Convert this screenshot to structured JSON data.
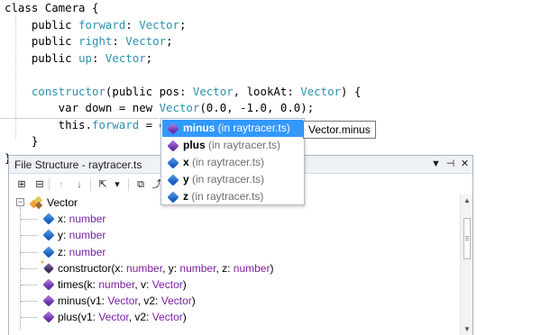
{
  "editor": {
    "lines": [
      [
        {
          "t": "class Camera {",
          "c": "kw"
        }
      ],
      [
        {
          "t": "    public ",
          "c": "kw"
        },
        {
          "t": "forward",
          "c": "field"
        },
        {
          "t": ": ",
          "c": "punct"
        },
        {
          "t": "Vector",
          "c": "type"
        },
        {
          "t": ";",
          "c": "punct"
        }
      ],
      [
        {
          "t": "    public ",
          "c": "kw"
        },
        {
          "t": "right",
          "c": "field"
        },
        {
          "t": ": ",
          "c": "punct"
        },
        {
          "t": "Vector",
          "c": "type"
        },
        {
          "t": ";",
          "c": "punct"
        }
      ],
      [
        {
          "t": "    public ",
          "c": "kw"
        },
        {
          "t": "up",
          "c": "field"
        },
        {
          "t": ": ",
          "c": "punct"
        },
        {
          "t": "Vector",
          "c": "type"
        },
        {
          "t": ";",
          "c": "punct"
        }
      ],
      [
        {
          "t": "",
          "c": "punct"
        }
      ],
      [
        {
          "t": "    ",
          "c": "punct"
        },
        {
          "t": "constructor",
          "c": "method"
        },
        {
          "t": "(public pos: ",
          "c": "kw"
        },
        {
          "t": "Vector",
          "c": "type"
        },
        {
          "t": ", lookAt: ",
          "c": "punct"
        },
        {
          "t": "Vector",
          "c": "type"
        },
        {
          "t": ") {",
          "c": "punct"
        }
      ],
      [
        {
          "t": "        var down = new ",
          "c": "kw"
        },
        {
          "t": "Vector",
          "c": "type"
        },
        {
          "t": "(0.0, -1.0, 0.0);",
          "c": "punct"
        }
      ],
      [
        {
          "t": "        this.",
          "c": "kw"
        },
        {
          "t": "forward",
          "c": "field"
        },
        {
          "t": " = down.",
          "c": "punct"
        }
      ],
      [
        {
          "t": "    }",
          "c": "punct"
        }
      ],
      [
        {
          "t": "}",
          "c": "punct"
        }
      ]
    ]
  },
  "completion": {
    "items": [
      {
        "name": "minus",
        "location": " (in raytracer.ts)",
        "kind": "method",
        "selected": true
      },
      {
        "name": "plus",
        "location": " (in raytracer.ts)",
        "kind": "method",
        "selected": false
      },
      {
        "name": "x",
        "location": " (in raytracer.ts)",
        "kind": "field",
        "selected": false
      },
      {
        "name": "y",
        "location": " (in raytracer.ts)",
        "kind": "field",
        "selected": false
      },
      {
        "name": "z",
        "location": " (in raytracer.ts)",
        "kind": "field",
        "selected": false
      }
    ],
    "tooltip": "Vector.minus"
  },
  "panel": {
    "title": "File Structure - raytracer.ts",
    "controls": {
      "dropdown": "▼",
      "pin": "⊣",
      "close": "✕"
    },
    "toolbar": [
      {
        "icon": "expand-all-icon",
        "glyph": "⊞",
        "state": "enabled"
      },
      {
        "icon": "collapse-all-icon",
        "glyph": "⊟",
        "state": "enabled"
      },
      {
        "icon": "move-up-icon",
        "glyph": "↑",
        "state": "disabled"
      },
      {
        "icon": "move-down-icon",
        "glyph": "↓",
        "state": "active"
      },
      {
        "icon": "export-icon",
        "glyph": "⇱",
        "state": "enabled"
      },
      {
        "icon": "export-dropdown-icon",
        "glyph": "▾",
        "state": "enabled"
      },
      {
        "icon": "region-icon",
        "glyph": "⧉",
        "state": "enabled"
      },
      {
        "icon": "goto-icon",
        "glyph": "⤴",
        "state": "enabled"
      }
    ],
    "tree": {
      "class_name": "Vector",
      "members": [
        {
          "kind": "field",
          "parts": [
            {
              "t": "x: ",
              "c": "name"
            },
            {
              "t": "number",
              "c": "type"
            }
          ]
        },
        {
          "kind": "field",
          "parts": [
            {
              "t": "y: ",
              "c": "name"
            },
            {
              "t": "number",
              "c": "type"
            }
          ]
        },
        {
          "kind": "field",
          "parts": [
            {
              "t": "z: ",
              "c": "name"
            },
            {
              "t": "number",
              "c": "type"
            }
          ]
        },
        {
          "kind": "ctor",
          "parts": [
            {
              "t": "constructor(x: ",
              "c": "name"
            },
            {
              "t": "number",
              "c": "type"
            },
            {
              "t": ", y: ",
              "c": "name"
            },
            {
              "t": "number",
              "c": "type"
            },
            {
              "t": ", z: ",
              "c": "name"
            },
            {
              "t": "number",
              "c": "type"
            },
            {
              "t": ")",
              "c": "name"
            }
          ]
        },
        {
          "kind": "method",
          "parts": [
            {
              "t": "times(k: ",
              "c": "name"
            },
            {
              "t": "number",
              "c": "type"
            },
            {
              "t": ", v: ",
              "c": "name"
            },
            {
              "t": "Vector",
              "c": "type"
            },
            {
              "t": ")",
              "c": "name"
            }
          ]
        },
        {
          "kind": "method",
          "parts": [
            {
              "t": "minus(v1: ",
              "c": "name"
            },
            {
              "t": "Vector",
              "c": "type"
            },
            {
              "t": ", v2: ",
              "c": "name"
            },
            {
              "t": "Vector",
              "c": "type"
            },
            {
              "t": ")",
              "c": "name"
            }
          ]
        },
        {
          "kind": "method",
          "parts": [
            {
              "t": "plus(v1: ",
              "c": "name"
            },
            {
              "t": "Vector",
              "c": "type"
            },
            {
              "t": ", v2: ",
              "c": "name"
            },
            {
              "t": "Vector",
              "c": "type"
            },
            {
              "t": ")",
              "c": "name"
            }
          ]
        }
      ]
    },
    "scrollbar": {
      "up": "▲",
      "down": "▼"
    }
  },
  "colors": {
    "identifier": "#2b91af",
    "type_text": "#7a1fa2",
    "selection": "#3399ff"
  }
}
